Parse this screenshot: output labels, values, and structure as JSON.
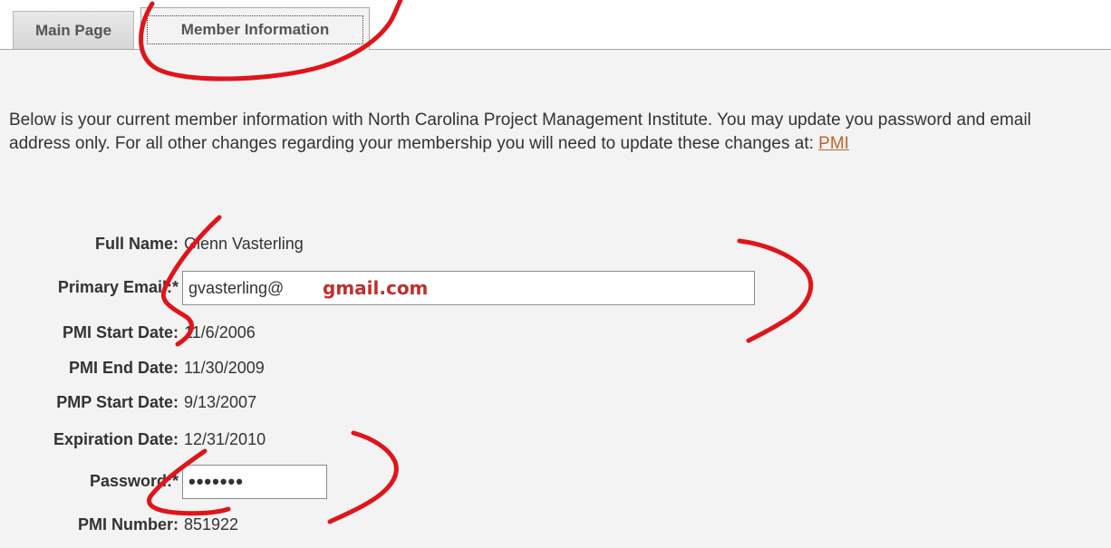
{
  "tabs": {
    "main_page": "Main Page",
    "member_information": "Member Information"
  },
  "intro": {
    "text_before_link": "Below is your current member information with North Carolina Project Management Institute. You may update you password and email address only. For all other changes regarding your membership you will need to update these changes at: ",
    "link_text": "PMI"
  },
  "fields": {
    "full_name": {
      "label": "Full Name:",
      "value": "Glenn Vasterling"
    },
    "primary_email": {
      "label": "Primary Email:*",
      "value": "gvasterling@",
      "overlay": "gmail.com"
    },
    "pmi_start_date": {
      "label": "PMI Start Date:",
      "value": "11/6/2006"
    },
    "pmi_end_date": {
      "label": "PMI End Date:",
      "value": "11/30/2009"
    },
    "pmp_start_date": {
      "label": "PMP Start Date:",
      "value": "9/13/2007"
    },
    "expiration_date": {
      "label": "Expiration Date:",
      "value": "12/31/2010"
    },
    "password": {
      "label": "Password:*",
      "value": "•••••••"
    },
    "pmi_number": {
      "label": "PMI Number:",
      "value": "851922"
    }
  },
  "colors": {
    "annotation": "#e0141a",
    "link": "#c0632c",
    "overlay_text": "#c0302b"
  }
}
